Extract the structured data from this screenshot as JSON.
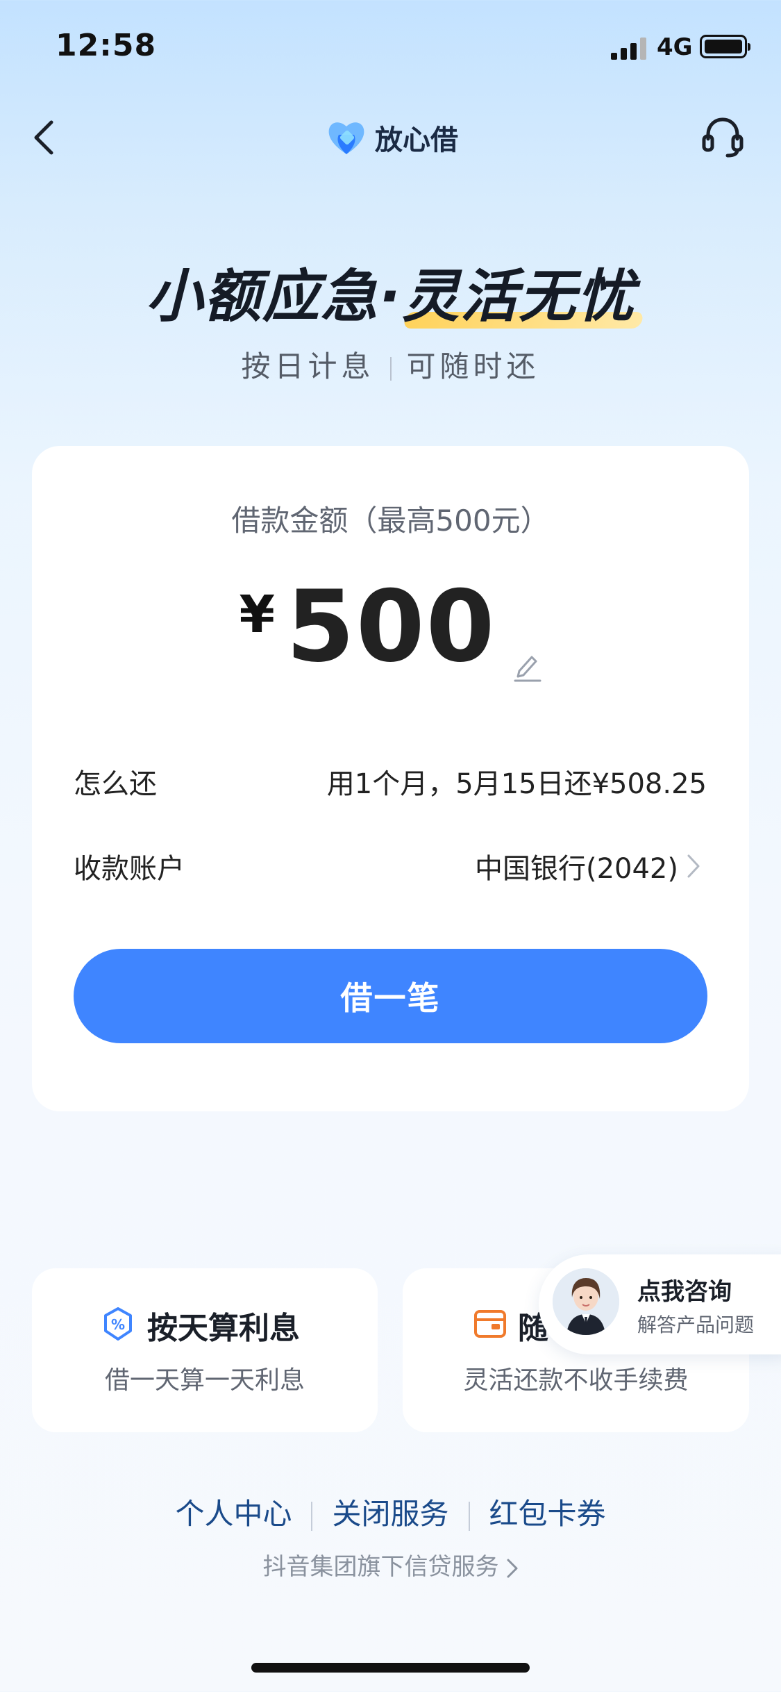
{
  "status_bar": {
    "time": "12:58",
    "network": "4G"
  },
  "nav": {
    "brand_name": "放心借",
    "back_icon": "chevron-left-icon",
    "support_icon": "headset-icon"
  },
  "hero": {
    "title_part1": "小额应急·",
    "title_part2": "灵活无忧",
    "sub_left": "按日计息",
    "sub_right": "可随时还"
  },
  "loan_card": {
    "amount_label": "借款金额（最高500元）",
    "currency": "¥",
    "amount": "500",
    "repay_label": "怎么还",
    "repay_value": "用1个月，5月15日还¥508.25",
    "account_label": "收款账户",
    "account_value": "中国银行(2042)",
    "cta_label": "借一笔"
  },
  "features": [
    {
      "title": "按天算利息",
      "desc": "借一天算一天利息",
      "icon": "percent-shield-icon"
    },
    {
      "title": "随",
      "desc": "灵活还款不收手续费",
      "icon": "wallet-icon"
    }
  ],
  "consult": {
    "title": "点我咨询",
    "subtitle": "解答产品问题"
  },
  "footer": {
    "links": [
      "个人中心",
      "关闭服务",
      "红包卡券"
    ],
    "note": "抖音集团旗下信贷服务"
  },
  "colors": {
    "primary": "#3f85ff",
    "link": "#1a4a8a",
    "highlight": "#ffd25a"
  }
}
